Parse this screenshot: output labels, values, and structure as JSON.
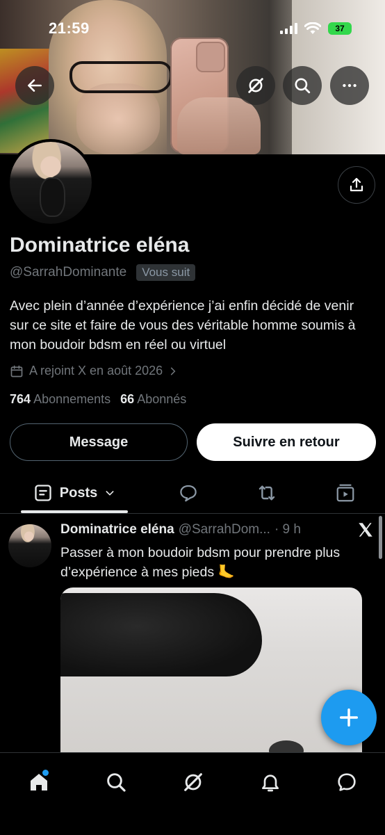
{
  "status_bar": {
    "time": "21:59",
    "battery": "37"
  },
  "profile": {
    "display_name": "Dominatrice eléna",
    "handle": "@SarrahDominante",
    "follows_you_badge": "Vous suit",
    "bio": "Avec plein d’année d’expérience j’ai enfin décidé de venir sur ce site et faire de vous des véritable homme soumis à mon boudoir bdsm en réel ou virtuel",
    "joined": "A rejoint X en août 2026",
    "following_count": "764",
    "following_label": "Abonnements",
    "followers_count": "66",
    "followers_label": "Abonnés"
  },
  "actions": {
    "message_label": "Message",
    "follow_back_label": "Suivre en retour"
  },
  "tabs": {
    "posts_label": "Posts"
  },
  "post": {
    "author_name": "Dominatrice eléna",
    "author_handle": "@SarrahDom...",
    "time": "· 9 h",
    "text": "Passer à mon boudoir bdsm pour prendre plus d’expérience à mes pieds 🦶"
  },
  "colors": {
    "accent": "#1d9bf0",
    "background": "#000000",
    "muted": "#71767b"
  }
}
